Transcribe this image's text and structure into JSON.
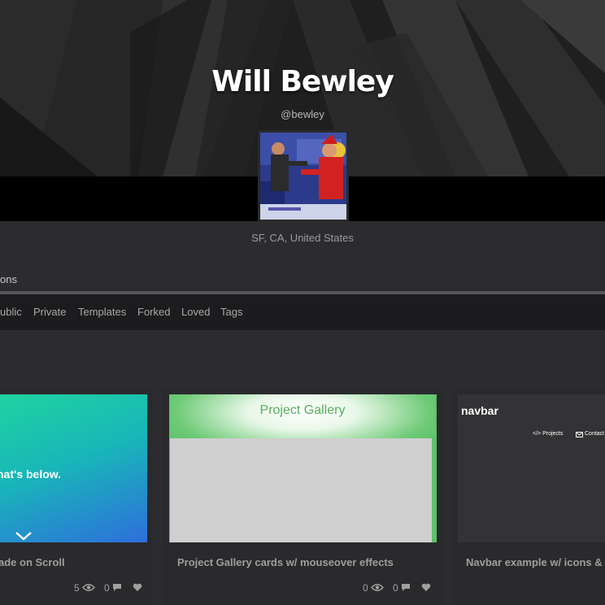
{
  "profile": {
    "name": "Will Bewley",
    "handle": "@bewley",
    "location": "SF, CA, United States",
    "avatar_icon": "profile-photo"
  },
  "tabs": {
    "main_partial": "ons"
  },
  "subnav": {
    "items": [
      "ublic",
      "Private",
      "Templates",
      "Forked",
      "Loved",
      "Tags"
    ]
  },
  "cards": [
    {
      "title": "ade on Scroll",
      "preview_text": "hat's below.",
      "views": "5",
      "comments": "0"
    },
    {
      "title": "Project Gallery cards w/ mouseover effects",
      "preview_heading": "Project Gallery",
      "views": "0",
      "comments": "0"
    },
    {
      "title": "Navbar example w/ icons & a",
      "preview_brand": "navbar",
      "preview_links": [
        "</> Projects",
        "Contact"
      ]
    }
  ],
  "icons": {
    "views": "eye-icon",
    "comments": "comment-icon",
    "loves": "heart-icon",
    "scroll": "chevron-down-icon"
  },
  "colors": {
    "page_bg": "#2c2c30",
    "subnav_bg": "#1c1c1e",
    "hero_bg": "#1d1d1d"
  }
}
